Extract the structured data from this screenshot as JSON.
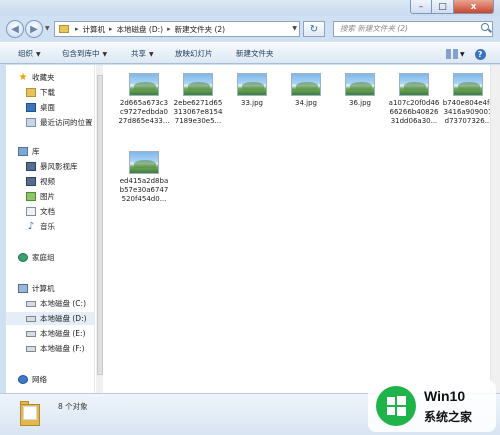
{
  "window": {
    "caption_buttons": {
      "minimize": "–",
      "maximize": "□",
      "close": "x"
    }
  },
  "address": {
    "crumbs": [
      "计算机",
      "本地磁盘 (D:)",
      "新建文件夹 (2)"
    ],
    "search_placeholder": "搜索 新建文件夹 (2)"
  },
  "toolbar": {
    "organize": "组织",
    "include_in_library": "包含到库中",
    "share": "共享",
    "slideshow": "放映幻灯片",
    "new_folder": "新建文件夹",
    "help": "?"
  },
  "nav": {
    "favorites": "收藏夹",
    "downloads": "下载",
    "desktop": "桌面",
    "recent": "最近访问的位置",
    "libraries": "库",
    "storm": "暴风影视库",
    "videos": "视频",
    "pictures": "图片",
    "documents": "文档",
    "music": "音乐",
    "homegroup": "家庭组",
    "computer": "计算机",
    "drive_c": "本地磁盘 (C:)",
    "drive_d": "本地磁盘 (D:)",
    "drive_e": "本地磁盘 (E:)",
    "drive_f": "本地磁盘 (F:)",
    "network": "网络"
  },
  "files": [
    {
      "name": "2d665a673c3c9727edbda027d865e433..."
    },
    {
      "name": "2ebe6271d65313067e81547189e30e5..."
    },
    {
      "name": "33.jpg"
    },
    {
      "name": "34.jpg"
    },
    {
      "name": "36.jpg"
    },
    {
      "name": "a107c20f0d4666266b4082631dd06a30..."
    },
    {
      "name": "b740e804e4fc3416a909001d73707326..."
    },
    {
      "name": "ed415a2d8bab57e30a6747520f454d0..."
    }
  ],
  "status": {
    "count": "8 个对象"
  },
  "watermark": {
    "line1": "Win10",
    "line2": "系统之家"
  }
}
